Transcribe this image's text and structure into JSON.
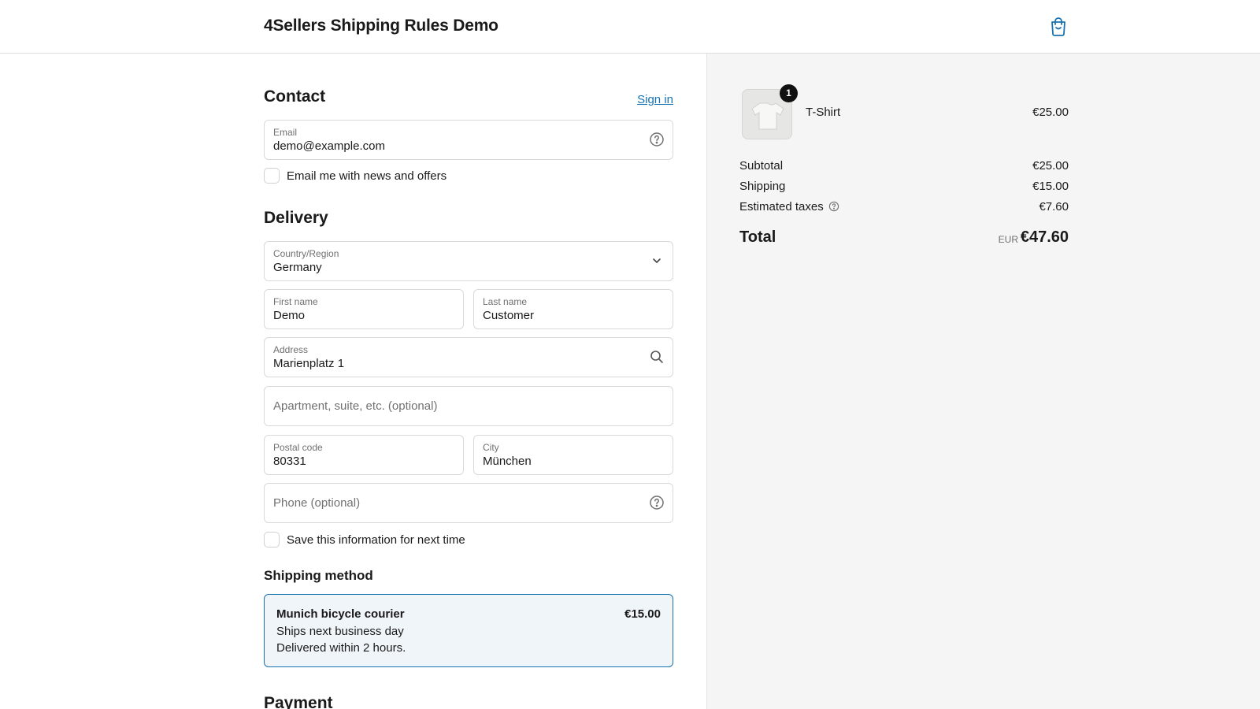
{
  "header": {
    "store_name": "4Sellers Shipping Rules Demo",
    "cart_icon": "shopping-bag-icon"
  },
  "contact": {
    "title": "Contact",
    "sign_in": "Sign in",
    "email_label": "Email",
    "email_value": "demo@example.com",
    "newsletter_label": "Email me with news and offers",
    "newsletter_checked": false
  },
  "delivery": {
    "title": "Delivery",
    "country_label": "Country/Region",
    "country_value": "Germany",
    "first_name_label": "First name",
    "first_name_value": "Demo",
    "last_name_label": "Last name",
    "last_name_value": "Customer",
    "address_label": "Address",
    "address_value": "Marienplatz 1",
    "apartment_placeholder": "Apartment, suite, etc. (optional)",
    "postal_label": "Postal code",
    "postal_value": "80331",
    "city_label": "City",
    "city_value": "München",
    "phone_placeholder": "Phone (optional)",
    "save_info_label": "Save this information for next time",
    "save_info_checked": false
  },
  "shipping_method": {
    "title": "Shipping method",
    "option": {
      "name": "Munich bicycle courier",
      "price": "€15.00",
      "line1": "Ships next business day",
      "line2": "Delivered within 2 hours.",
      "selected": true
    }
  },
  "payment": {
    "title": "Payment"
  },
  "summary": {
    "item": {
      "name": "T-Shirt",
      "quantity": "1",
      "price": "€25.00"
    },
    "subtotal_label": "Subtotal",
    "subtotal_value": "€25.00",
    "shipping_label": "Shipping",
    "shipping_value": "€15.00",
    "taxes_label": "Estimated taxes",
    "taxes_value": "€7.60",
    "total_label": "Total",
    "total_currency": "EUR",
    "total_value": "€47.60"
  },
  "colors": {
    "accent": "#1773b0",
    "summary_bg": "#f5f5f5",
    "selected_bg": "#f0f5fa"
  }
}
